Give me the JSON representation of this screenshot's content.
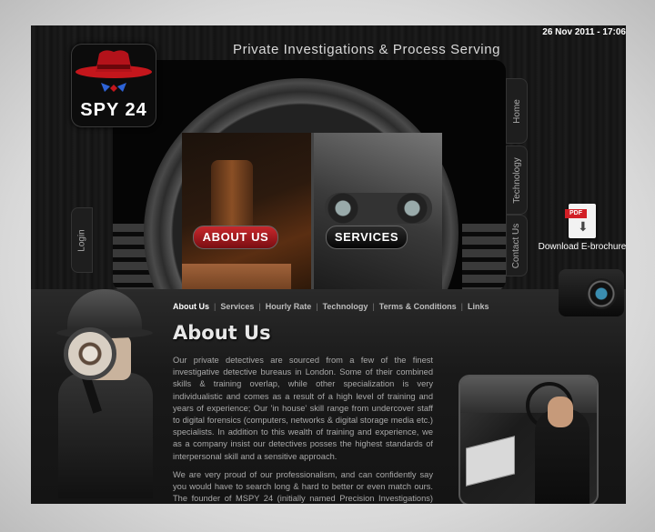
{
  "header": {
    "datetime": "26 Nov 2011 - 17:06",
    "tagline": "Private Investigations & Process Serving",
    "logo_text": "SPY 24"
  },
  "hero": {
    "about_button": "ABOUT US",
    "services_button": "SERVICES"
  },
  "side_tabs": {
    "home": "Home",
    "technology": "Technology",
    "contact": "Contact Us",
    "login": "Login"
  },
  "download": {
    "pdf_label": "PDF",
    "label": "Download E-brochure"
  },
  "nav": {
    "items": [
      "About Us",
      "Services",
      "Hourly Rate",
      "Technology",
      "Terms & Conditions",
      "Links"
    ],
    "active": "About Us"
  },
  "main": {
    "heading": "About Us",
    "paragraph1": "Our private detectives are sourced from a few of the finest investigative detective bureaus in London. Some of their combined skills & training overlap, while other specialization is very individualistic and comes as a result of a high level of training and years of experience; Our 'in house' skill range from undercover staff to digital forensics (computers, networks & digital storage media etc.) specialists. In addition to this wealth of training and experience, we as a company insist our detectives posses the highest standards of interpersonal skill and a sensitive approach.",
    "paragraph2": "We are very proud of our professionalism, and can confidently say you would have to search long & hard to better or even match ours. The founder of MSPY 24 (initially named Precision Investigations) has, in"
  }
}
